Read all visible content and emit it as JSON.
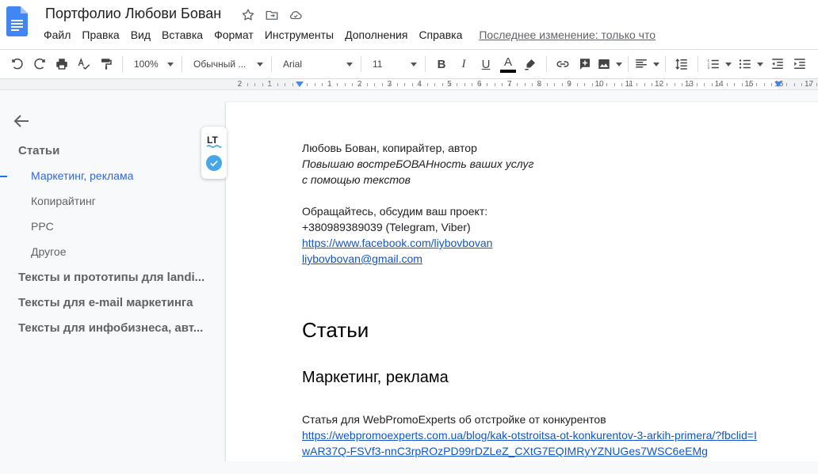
{
  "doc": {
    "title": "Портфолио Любови Бован"
  },
  "menu": {
    "items": [
      "Файл",
      "Правка",
      "Вид",
      "Вставка",
      "Формат",
      "Инструменты",
      "Дополнения",
      "Справка"
    ],
    "last_edit": "Последнее изменение: только что"
  },
  "toolbar": {
    "zoom": "100%",
    "style": "Обычный ...",
    "font": "Arial",
    "size": "11",
    "bold": "B",
    "italic": "I",
    "underline": "U",
    "text_color": "A",
    "text_color_value": "#000000"
  },
  "ruler": {
    "numbers": [
      "2",
      "1",
      "1",
      "2",
      "3",
      "4",
      "5",
      "6",
      "7",
      "8",
      "9",
      "10",
      "11",
      "12",
      "13",
      "14",
      "15",
      "16",
      "17"
    ]
  },
  "outline": {
    "items": [
      {
        "label": "Статьи",
        "level": 1
      },
      {
        "label": "Маркетинг, реклама",
        "level": 2,
        "active": true
      },
      {
        "label": "Копирайтинг",
        "level": 2
      },
      {
        "label": "PPC",
        "level": 2
      },
      {
        "label": "Другое",
        "level": 2
      },
      {
        "label": "Тексты и прототипы для landi...",
        "level": 1
      },
      {
        "label": "Тексты для e-mail маркетинга",
        "level": 1
      },
      {
        "label": "Тексты для инфобизнеса, авт...",
        "level": 1
      }
    ]
  },
  "lt": {
    "logo_text": "LT"
  },
  "content": {
    "line1": "Любовь Бован, копирайтер, автор",
    "line2": "Повышаю востреБОВАНность ваших услуг",
    "line3": "с помощью текстов",
    "line4": "Обращайтесь, обсудим ваш проект:",
    "phone": "+380989389039 (Telegram, Viber)",
    "facebook": "https://www.facebook.com/liybovbovan",
    "email": "liybovbovan@gmail.com",
    "heading1": "Статьи",
    "heading2": "Маркетинг, реклама",
    "article_title": "Статья для WebPromoExperts об отстройке от конкурентов",
    "article_link_1": "https://webpromoexperts.com.ua/blog/kak-otstroitsa-ot-konkurentov-3-arkih-primera/?fbclid=I",
    "article_link_2": "wAR37Q-FSVf3-nnC3rpROzPD99rDZLeZ_CXtG7EQIMRyYZNUGes7WSC6eEMg"
  }
}
